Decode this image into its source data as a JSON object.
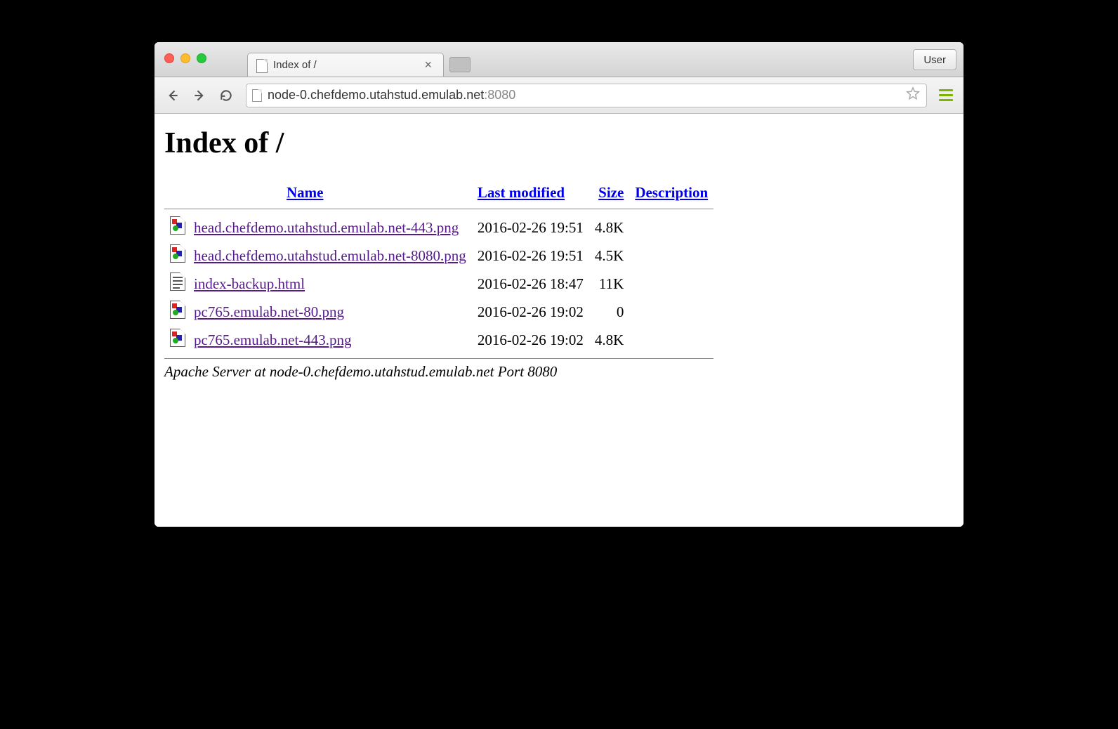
{
  "window": {
    "user_button": "User",
    "tab_title": "Index of /"
  },
  "toolbar": {
    "url_host": "node-0.chefdemo.utahstud.emulab.net",
    "url_port": ":8080"
  },
  "page": {
    "heading": "Index of /",
    "columns": {
      "name": "Name",
      "modified": "Last modified",
      "size": "Size",
      "description": "Description"
    },
    "rows": [
      {
        "icon": "img",
        "name": "head.chefdemo.utahstud.emulab.net-443.png",
        "modified": "2016-02-26 19:51",
        "size": "4.8K"
      },
      {
        "icon": "img",
        "name": "head.chefdemo.utahstud.emulab.net-8080.png",
        "modified": "2016-02-26 19:51",
        "size": "4.5K"
      },
      {
        "icon": "txt",
        "name": "index-backup.html",
        "modified": "2016-02-26 18:47",
        "size": "11K"
      },
      {
        "icon": "img",
        "name": "pc765.emulab.net-80.png",
        "modified": "2016-02-26 19:02",
        "size": "0"
      },
      {
        "icon": "img",
        "name": "pc765.emulab.net-443.png",
        "modified": "2016-02-26 19:02",
        "size": "4.8K"
      }
    ],
    "server_signature": "Apache Server at node-0.chefdemo.utahstud.emulab.net Port 8080"
  }
}
